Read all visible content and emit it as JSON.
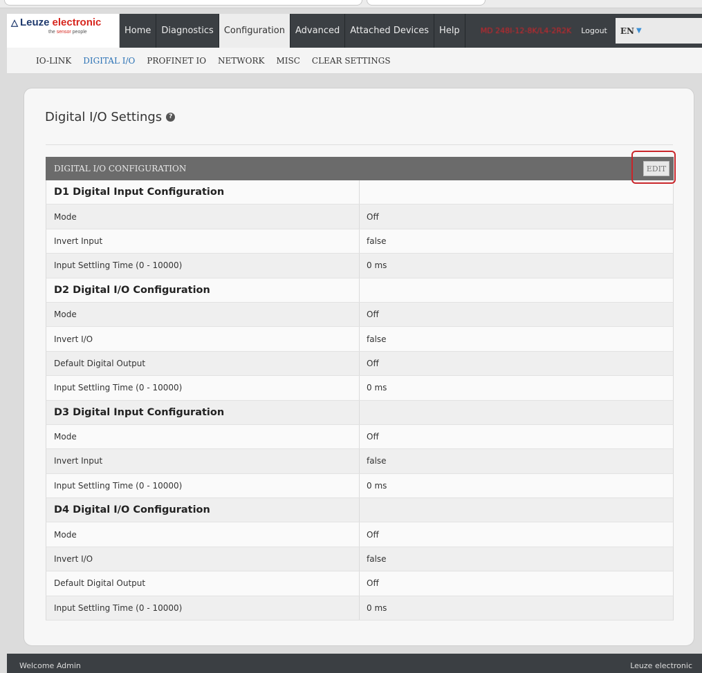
{
  "brand": {
    "name_part1": "Leuze",
    "name_part2": "electronic",
    "tagline_pre": "the",
    "tagline_accent": "sensor",
    "tagline_post": "people"
  },
  "nav": {
    "items": [
      {
        "label": "Home"
      },
      {
        "label": "Diagnostics"
      },
      {
        "label": "Configuration"
      },
      {
        "label": "Advanced"
      },
      {
        "label": "Attached Devices"
      },
      {
        "label": "Help"
      }
    ],
    "active": "Configuration",
    "device_name": "MD 248I-12-8K/L4-2R2K",
    "logout_label": "Logout",
    "language": "EN"
  },
  "subnav": {
    "items": [
      {
        "label": "IO-LINK"
      },
      {
        "label": "DIGITAL I/O"
      },
      {
        "label": "PROFINET IO"
      },
      {
        "label": "NETWORK"
      },
      {
        "label": "MISC"
      },
      {
        "label": "CLEAR SETTINGS"
      }
    ],
    "active": "DIGITAL I/O"
  },
  "page": {
    "title": "Digital I/O Settings",
    "table_header": "DIGITAL I/O CONFIGURATION",
    "edit_label": "EDIT"
  },
  "rows": [
    {
      "label": "D1 Digital Input Configuration",
      "value": "",
      "section": true
    },
    {
      "label": "Mode",
      "value": "Off"
    },
    {
      "label": "Invert Input",
      "value": "false"
    },
    {
      "label": "Input Settling Time (0 - 10000)",
      "value": "0 ms"
    },
    {
      "label": "D2 Digital I/O Configuration",
      "value": "",
      "section": true
    },
    {
      "label": "Mode",
      "value": "Off"
    },
    {
      "label": "Invert I/O",
      "value": "false"
    },
    {
      "label": "Default Digital Output",
      "value": "Off"
    },
    {
      "label": "Input Settling Time (0 - 10000)",
      "value": "0 ms"
    },
    {
      "label": "D3 Digital Input Configuration",
      "value": "",
      "section": true
    },
    {
      "label": "Mode",
      "value": "Off"
    },
    {
      "label": "Invert Input",
      "value": "false"
    },
    {
      "label": "Input Settling Time (0 - 10000)",
      "value": "0 ms"
    },
    {
      "label": "D4 Digital I/O Configuration",
      "value": "",
      "section": true
    },
    {
      "label": "Mode",
      "value": "Off"
    },
    {
      "label": "Invert I/O",
      "value": "false"
    },
    {
      "label": "Default Digital Output",
      "value": "Off"
    },
    {
      "label": "Input Settling Time (0 - 10000)",
      "value": "0 ms"
    }
  ],
  "footer": {
    "welcome": "Welcome Admin",
    "company": "Leuze electronic"
  },
  "colors": {
    "brand_blue": "#1f3a6e",
    "brand_red": "#d7261e",
    "topbar": "#3b3f43",
    "link_blue": "#2b72b5",
    "highlight_red": "#c9252a"
  }
}
